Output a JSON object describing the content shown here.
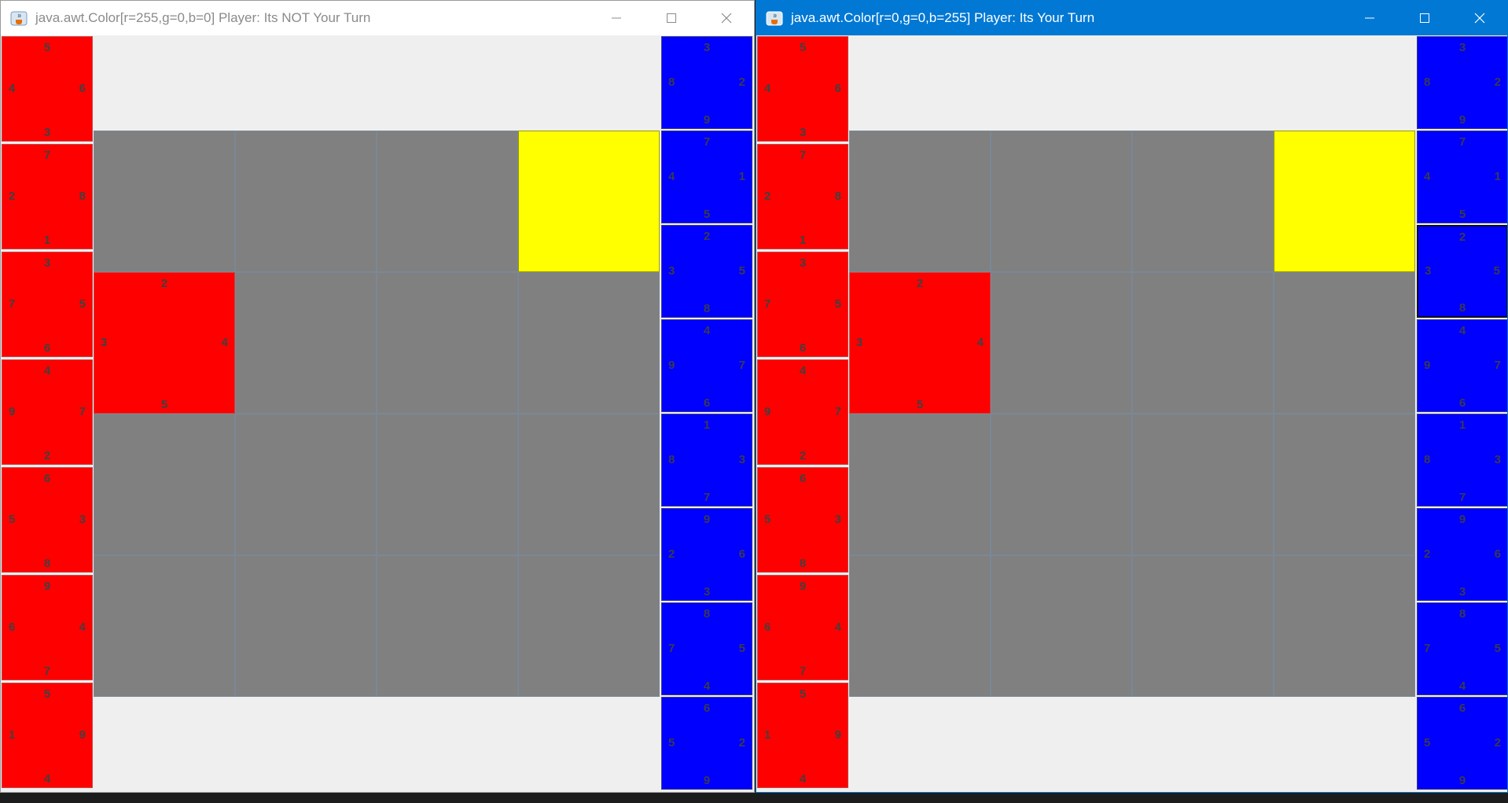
{
  "windows": [
    {
      "title": "java.awt.Color[r=255,g=0,b=0] Player: Its NOT Your Turn",
      "active": false,
      "controls": {
        "minimize": "—",
        "maximize": "☐",
        "close": "✕"
      }
    },
    {
      "title": "java.awt.Color[r=0,g=0,b=255] Player: Its Your Turn",
      "active": true,
      "controls": {
        "minimize": "—",
        "maximize": "☐",
        "close": "✕"
      }
    }
  ],
  "colors": {
    "red": "#ff0000",
    "blue": "#0000ff",
    "yellow": "#ffff00",
    "board": "#808080",
    "background": "#efefef"
  },
  "red_hand": [
    {
      "top": "5",
      "left": "4",
      "right": "6",
      "bottom": "3"
    },
    {
      "top": "7",
      "left": "2",
      "right": "8",
      "bottom": "1"
    },
    {
      "top": "3",
      "left": "7",
      "right": "5",
      "bottom": "6"
    },
    {
      "top": "4",
      "left": "9",
      "right": "7",
      "bottom": "2"
    },
    {
      "top": "6",
      "left": "5",
      "right": "3",
      "bottom": "8"
    },
    {
      "top": "9",
      "left": "6",
      "right": "4",
      "bottom": "7"
    },
    {
      "top": "5",
      "left": "1",
      "right": "9",
      "bottom": "4"
    }
  ],
  "blue_hand": [
    {
      "top": "3",
      "left": "8",
      "right": "2",
      "bottom": "9"
    },
    {
      "top": "7",
      "left": "4",
      "right": "1",
      "bottom": "5"
    },
    {
      "top": "2",
      "left": "3",
      "right": "5",
      "bottom": "8"
    },
    {
      "top": "4",
      "left": "9",
      "right": "7",
      "bottom": "6"
    },
    {
      "top": "1",
      "left": "8",
      "right": "3",
      "bottom": "7"
    },
    {
      "top": "9",
      "left": "2",
      "right": "6",
      "bottom": "3"
    },
    {
      "top": "8",
      "left": "7",
      "right": "5",
      "bottom": "4"
    },
    {
      "top": "6",
      "left": "5",
      "right": "2",
      "bottom": "9"
    }
  ],
  "board": {
    "rows": 4,
    "cols": 4,
    "placed": [
      {
        "row": 0,
        "col": 3,
        "color": "yellow",
        "top": "",
        "left": "",
        "right": "",
        "bottom": ""
      },
      {
        "row": 1,
        "col": 0,
        "color": "red",
        "top": "2",
        "left": "3",
        "right": "4",
        "bottom": "5"
      }
    ]
  },
  "selected_blue_index_right": 2
}
